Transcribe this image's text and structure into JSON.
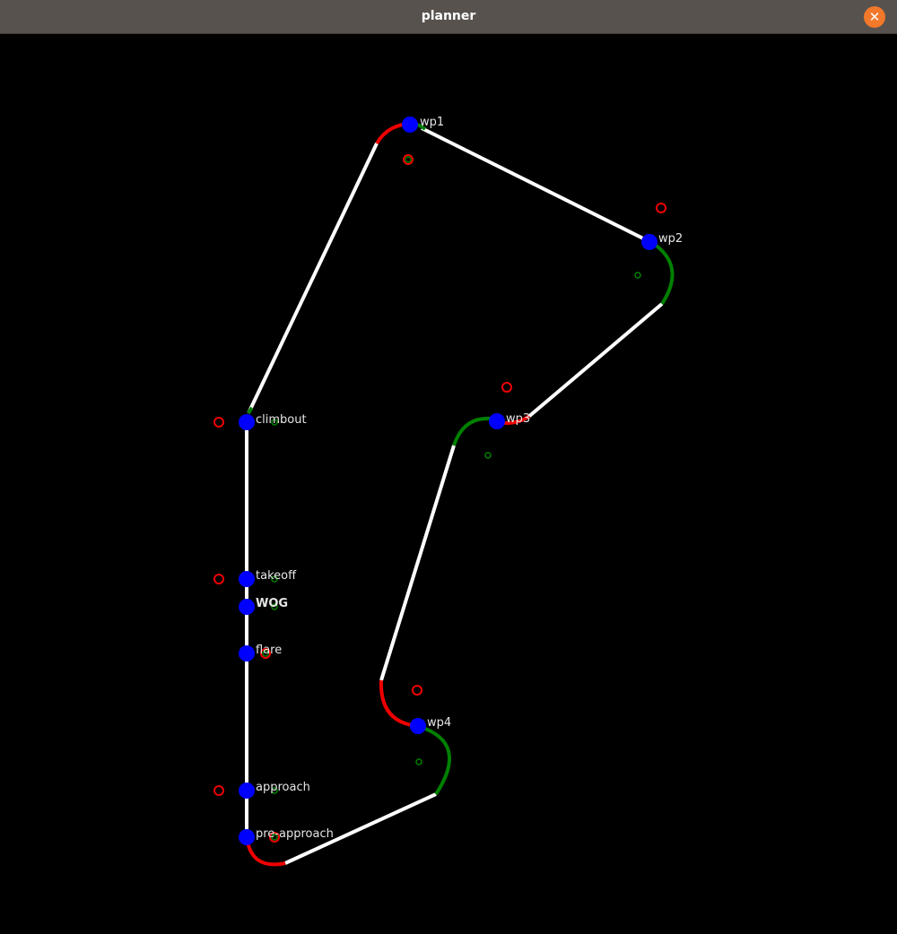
{
  "window": {
    "title": "planner",
    "close_icon": "close-icon",
    "close_glyph": "✕",
    "colors": {
      "titlebar": "#58524e",
      "close": "#f2782a"
    }
  },
  "canvas": {
    "background": "#000000",
    "colors": {
      "straight_segment": "#ffffff",
      "turn_right_arc": "#ee0000",
      "turn_left_arc": "#008000",
      "waypoint_marker": "#0000ff",
      "right_center_circle": "#ee0000",
      "left_center_circle": "#008000"
    },
    "waypoints": [
      {
        "id": "wp1",
        "label": "wp1"
      },
      {
        "id": "wp2",
        "label": "wp2"
      },
      {
        "id": "wp3",
        "label": "wp3"
      },
      {
        "id": "wp4",
        "label": "wp4"
      },
      {
        "id": "pre-approach",
        "label": "pre-approach"
      },
      {
        "id": "approach",
        "label": "approach"
      },
      {
        "id": "flare",
        "label": "flare"
      },
      {
        "id": "wog",
        "label": "WOG"
      },
      {
        "id": "takeoff",
        "label": "takeoff"
      },
      {
        "id": "climbout",
        "label": "climbout"
      }
    ]
  }
}
